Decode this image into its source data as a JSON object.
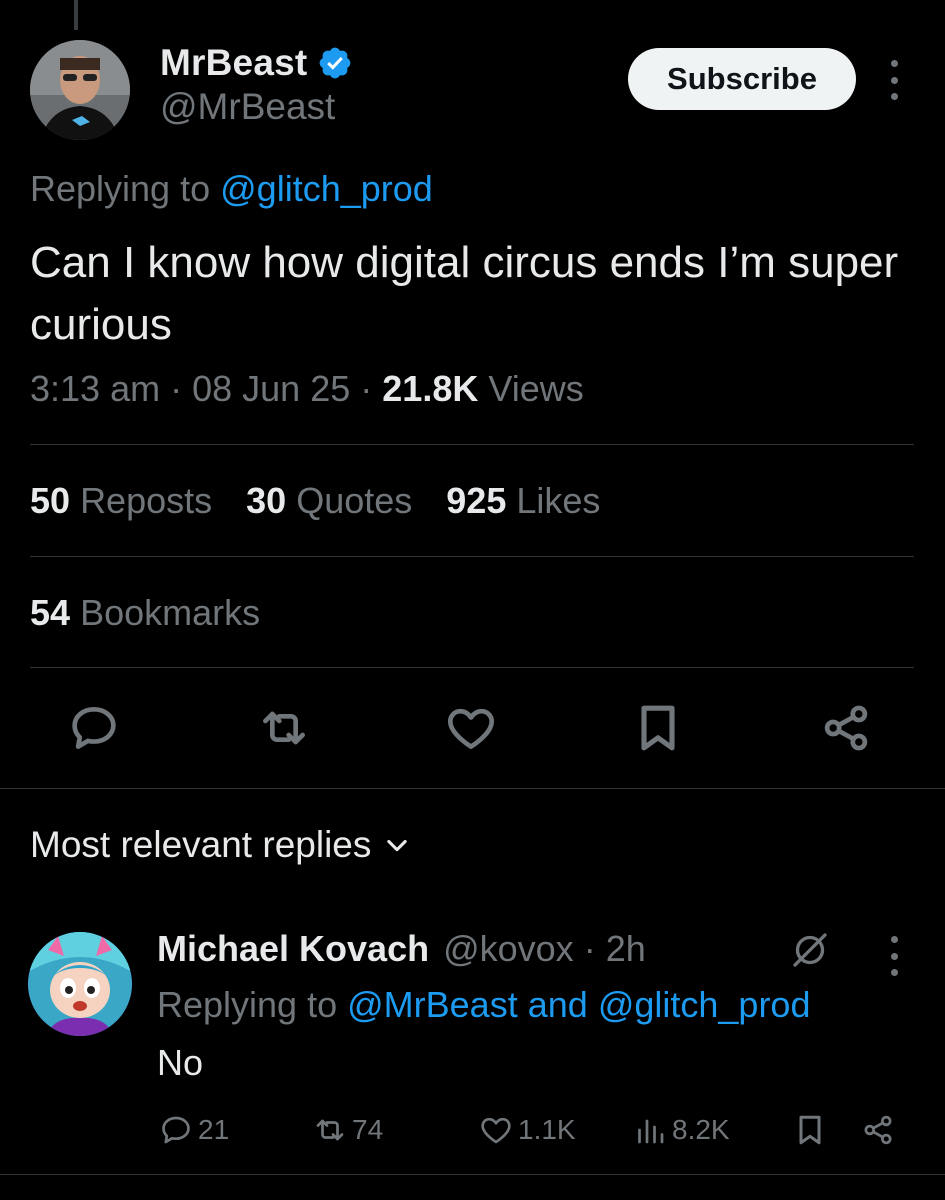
{
  "tweet": {
    "author_name": "MrBeast",
    "author_handle": "@MrBeast",
    "subscribe_label": "Subscribe",
    "replying_prefix": "Replying to",
    "replying_handle": "@glitch_prod",
    "text": "Can I know how digital circus ends I’m super curious",
    "time": "3:13 am",
    "date": "08 Jun 25",
    "views_count": "21.8K",
    "views_label": "Views",
    "separator": "·"
  },
  "stats": {
    "reposts_count": "50",
    "reposts_label": "Reposts",
    "quotes_count": "30",
    "quotes_label": "Quotes",
    "likes_count": "925",
    "likes_label": "Likes",
    "bookmarks_count": "54",
    "bookmarks_label": "Bookmarks"
  },
  "actions": [
    "reply-icon",
    "repost-icon",
    "like-icon",
    "bookmark-icon",
    "share-icon"
  ],
  "replies": {
    "sort_label": "Most relevant replies"
  },
  "reply": {
    "name": "Michael Kovach",
    "handle": "@kovox",
    "time": "2h",
    "replying_prefix": "Replying to",
    "replying_to_1": "@MrBeast",
    "replying_and": "and",
    "replying_to_2": "@glitch_prod",
    "text": "No",
    "reply_count": "21",
    "repost_count": "74",
    "like_count": "1.1K",
    "views_count": "8.2K"
  },
  "colors": {
    "background": "#000000",
    "text": "#e7e9ea",
    "muted": "#71767b",
    "link": "#1d9bf0",
    "verified": "#1d9bf0",
    "divider": "#2f3336"
  }
}
